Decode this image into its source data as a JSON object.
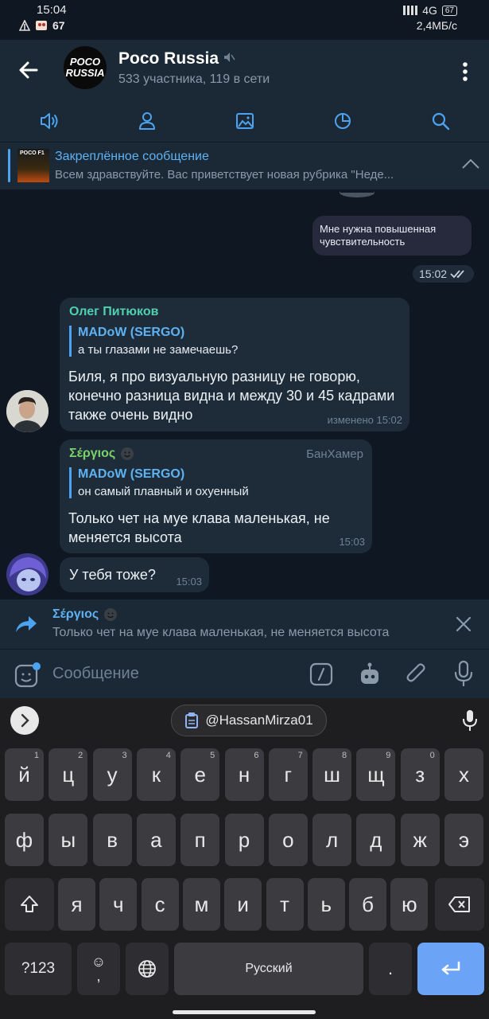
{
  "status": {
    "time": "15:04",
    "battery_left": "67",
    "network": "4G",
    "battery": "67",
    "speed": "2,4МБ/с"
  },
  "header": {
    "avatar_line1": "POCO",
    "avatar_line2": "RUSSIA",
    "title": "Poco Russia",
    "subtitle": "533 участника, 119 в сети"
  },
  "toolbar": {
    "icons": [
      "voice-chat-icon",
      "members-icon",
      "media-icon",
      "history-icon",
      "search-icon"
    ]
  },
  "pinned": {
    "thumb_label": "POCO F1",
    "title": "Закреплённое сообщение",
    "text": "Всем здравствуйте. Вас приветствует новая рубрика \"Неде..."
  },
  "messages": {
    "outgoing": {
      "text": "Мне нужна повышенная чувствительность",
      "time": "15:02"
    },
    "msg1": {
      "sender": "Олег Питюков",
      "sender_color": "#4fd0b0",
      "quote_name": "MADoW (SERGO)",
      "quote_text": "а ты глазами не замечаешь?",
      "text": "Биля, я про визуальную разницу не говорю, конечно разница видна и между 30 и 45 кадрами также очень видно",
      "meta": "изменено 15:02"
    },
    "msg2": {
      "sender": "Σέργιος",
      "sender_color": "#7ad36a",
      "rank": "БанХамер",
      "quote_name": "MADoW (SERGO)",
      "quote_text": "он самый плавный и охуенный",
      "text": "Только чет на муе клава маленькая, не меняется высота",
      "time": "15:03"
    },
    "msg3": {
      "text": "У тебя тоже?",
      "time": "15:03"
    }
  },
  "reply": {
    "name": "Σέργιος",
    "text": "Только чет на муе клава маленькая, не меняется высота"
  },
  "input": {
    "placeholder": "Сообщение"
  },
  "keyboard": {
    "suggestion": "@HassanMirza01",
    "row1": [
      {
        "k": "й",
        "n": "1"
      },
      {
        "k": "ц",
        "n": "2"
      },
      {
        "k": "у",
        "n": "3"
      },
      {
        "k": "к",
        "n": "4"
      },
      {
        "k": "е",
        "n": "5"
      },
      {
        "k": "н",
        "n": "6"
      },
      {
        "k": "г",
        "n": "7"
      },
      {
        "k": "ш",
        "n": "8"
      },
      {
        "k": "щ",
        "n": "9"
      },
      {
        "k": "з",
        "n": "0"
      },
      {
        "k": "х",
        "n": ""
      }
    ],
    "row2": [
      "ф",
      "ы",
      "в",
      "а",
      "п",
      "р",
      "о",
      "л",
      "д",
      "ж",
      "э"
    ],
    "row3": [
      "я",
      "ч",
      "с",
      "м",
      "и",
      "т",
      "ь",
      "б",
      "ю"
    ],
    "numbers_key": "?123",
    "emoji_key": "☺",
    "comma": ",",
    "space": "Русский",
    "period": "."
  }
}
